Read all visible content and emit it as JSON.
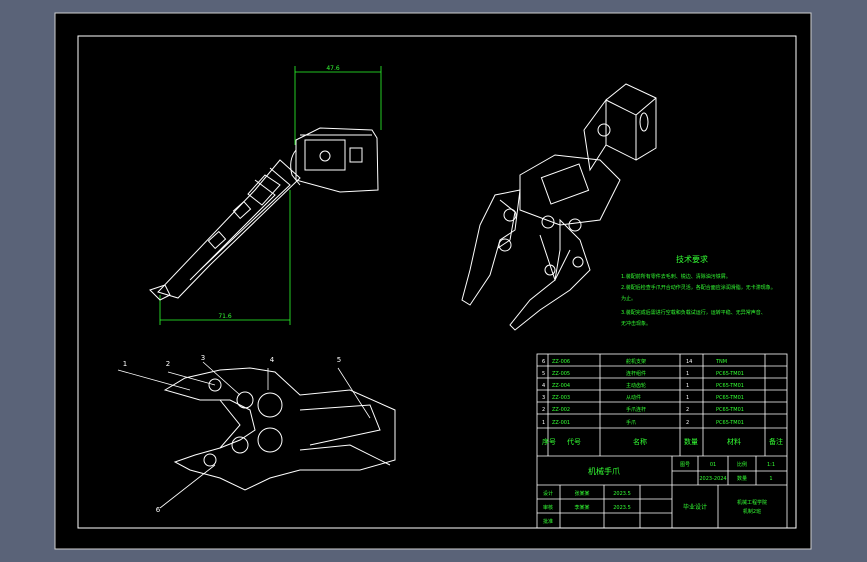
{
  "colors": {
    "background": "#5a6378",
    "drawing": "#000000",
    "line": "#ffffff",
    "annotation": "#33ff33"
  },
  "dimensions": {
    "top_width": "47.6",
    "bottom_width": "71.6"
  },
  "balloons": [
    "1",
    "2",
    "3",
    "4",
    "5",
    "6"
  ],
  "tech_req": {
    "title": "技术要求",
    "lines": [
      "1.装配前所有零件去毛刺、锐边、清除油污铁屑。",
      "2.装配后检查手爪开合动作灵活，各配合面应涂润滑脂，无卡滞现象。",
      "   为止。",
      "3.装配完成后需进行空载和负载试运行，运转平稳、无异常声音、",
      "   无冲击现象。"
    ]
  },
  "bom": {
    "rows": [
      {
        "no": "6",
        "code": "ZZ-006",
        "name": "舵机支架",
        "qty": "14",
        "material": "TNM",
        "note": ""
      },
      {
        "no": "5",
        "code": "ZZ-005",
        "name": "连杆组件",
        "qty": "1",
        "material": "PC65-TM01",
        "note": ""
      },
      {
        "no": "4",
        "code": "ZZ-004",
        "name": "主动齿轮",
        "qty": "1",
        "material": "PC65-TM01",
        "note": ""
      },
      {
        "no": "3",
        "code": "ZZ-003",
        "name": "从动件",
        "qty": "1",
        "material": "PC65-TM01",
        "note": ""
      },
      {
        "no": "2",
        "code": "ZZ-002",
        "name": "手爪连杆",
        "qty": "2",
        "material": "PC65-TM01",
        "note": ""
      },
      {
        "no": "1",
        "code": "ZZ-001",
        "name": "手爪",
        "qty": "2",
        "material": "PC65-TM01",
        "note": ""
      }
    ],
    "header": {
      "no": "序号",
      "code": "代号",
      "name": "名称",
      "qty": "数量",
      "material": "材料",
      "note": "备注"
    }
  },
  "title_block": {
    "drawing_name": "机械手爪",
    "scale_label": "图号",
    "scale_value": "01",
    "ratio_label": "比例",
    "ratio_value": "1:1",
    "sheet_code": "2023-2024",
    "count_label": "数量",
    "count_value": "1",
    "designer_label": "设计",
    "designer_name": "张某某",
    "design_date": "2023.5",
    "checker_label": "审核",
    "checker_name": "李某某",
    "check_date": "2023.5",
    "approve_label": "批准",
    "school_label": "毕业设计",
    "school_name": "机械工程学院",
    "school_sub": "机制2班"
  }
}
